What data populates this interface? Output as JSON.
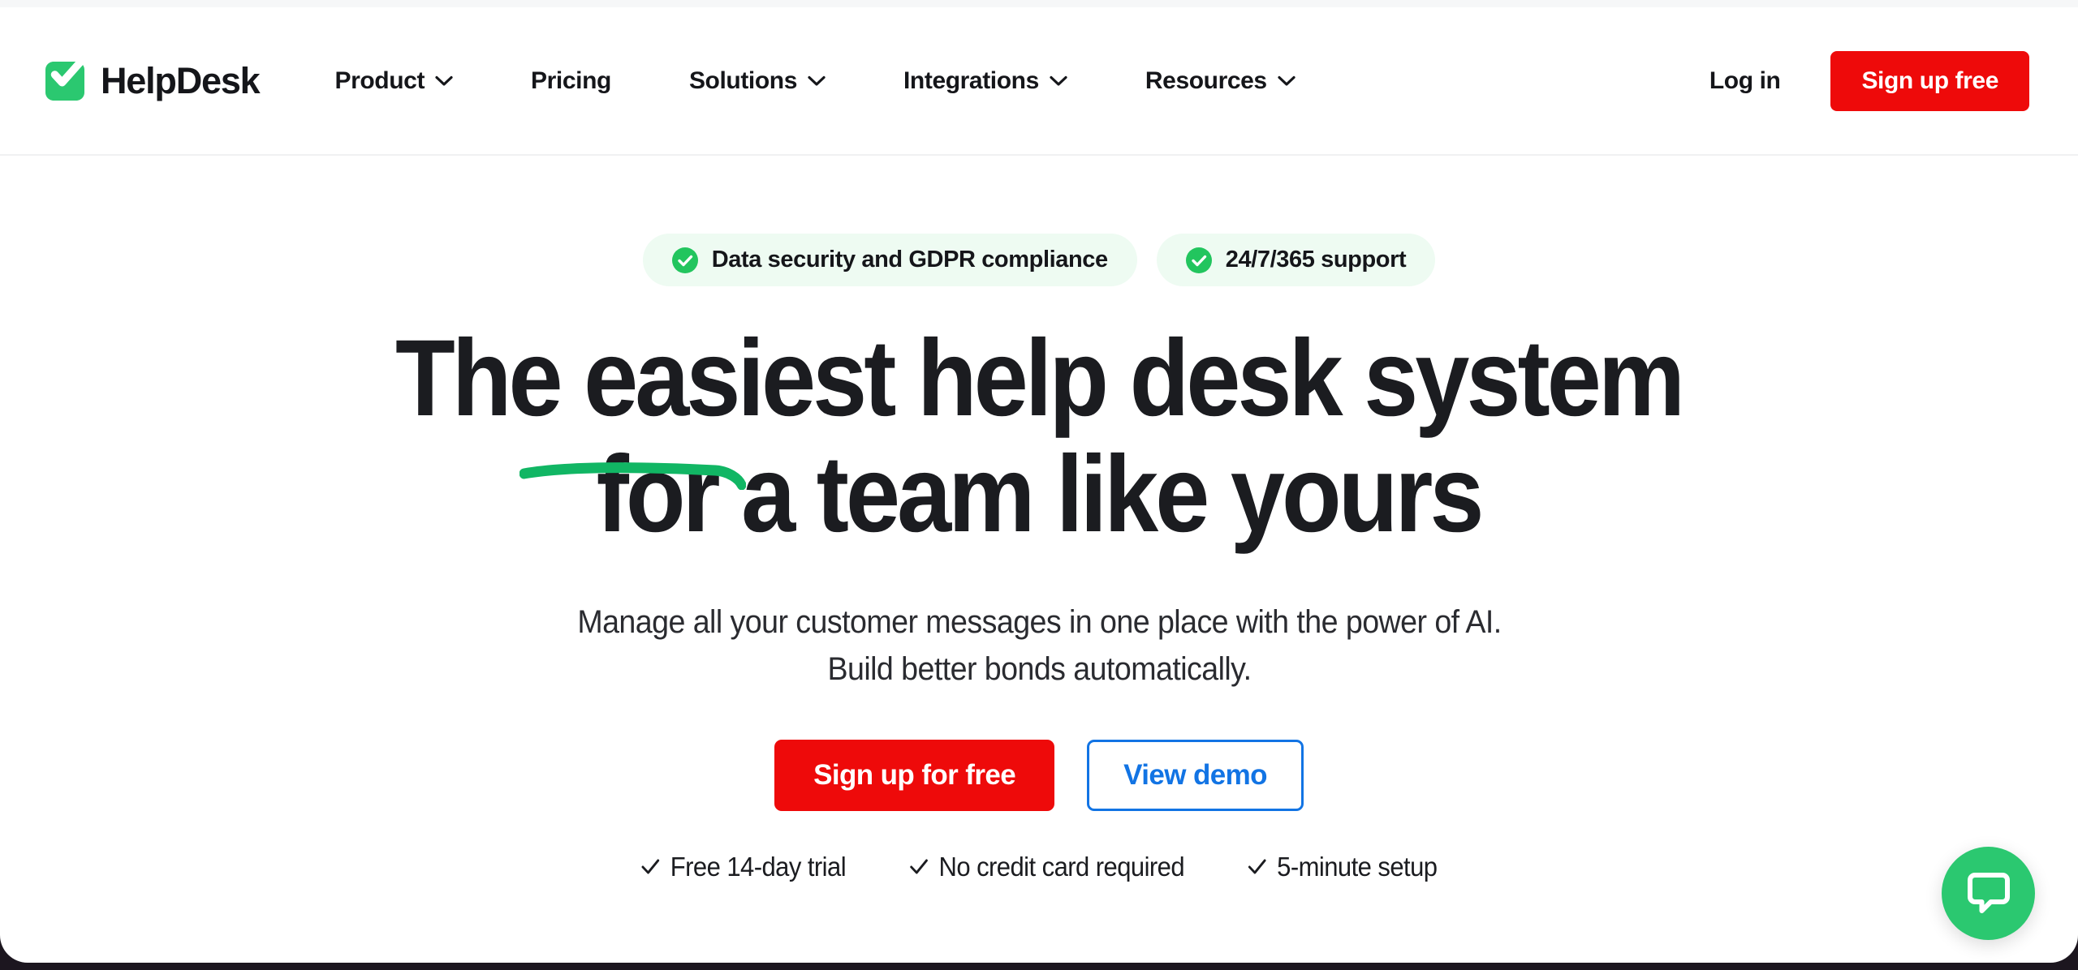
{
  "brand": {
    "name": "HelpDesk",
    "logo_icon": "checkbox-check-icon",
    "logo_color": "#2bc870"
  },
  "header": {
    "nav": [
      {
        "label": "Product",
        "has_dropdown": true,
        "icon": "chevron-down-icon"
      },
      {
        "label": "Pricing",
        "has_dropdown": false
      },
      {
        "label": "Solutions",
        "has_dropdown": true,
        "icon": "chevron-down-icon"
      },
      {
        "label": "Integrations",
        "has_dropdown": true,
        "icon": "chevron-down-icon"
      },
      {
        "label": "Resources",
        "has_dropdown": true,
        "icon": "chevron-down-icon"
      }
    ],
    "login_label": "Log in",
    "signup_label": "Sign up free",
    "signup_color": "#ee0a0a"
  },
  "hero": {
    "badges": [
      {
        "label": "Data security and GDPR compliance",
        "icon": "check-circle-icon"
      },
      {
        "label": "24/7/365 support",
        "icon": "check-circle-icon"
      }
    ],
    "badge_bg": "#eefbf2",
    "headline_line1": "The easiest help desk system",
    "headline_line2": "for a team like yours",
    "underline_color": "#11b664",
    "subhead_line1": "Manage all your customer messages in one place with the power of AI.",
    "subhead_line2": "Build better bonds automatically.",
    "cta_primary": "Sign up for free",
    "cta_primary_color": "#ee0a0a",
    "cta_secondary": "View demo",
    "cta_secondary_color": "#1274e4",
    "features": [
      {
        "label": "Free 14-day trial",
        "icon": "check-icon"
      },
      {
        "label": "No credit card required",
        "icon": "check-icon"
      },
      {
        "label": "5-minute setup",
        "icon": "check-icon"
      }
    ]
  },
  "chat": {
    "icon": "chat-bubble-icon",
    "color": "#2bc870"
  }
}
